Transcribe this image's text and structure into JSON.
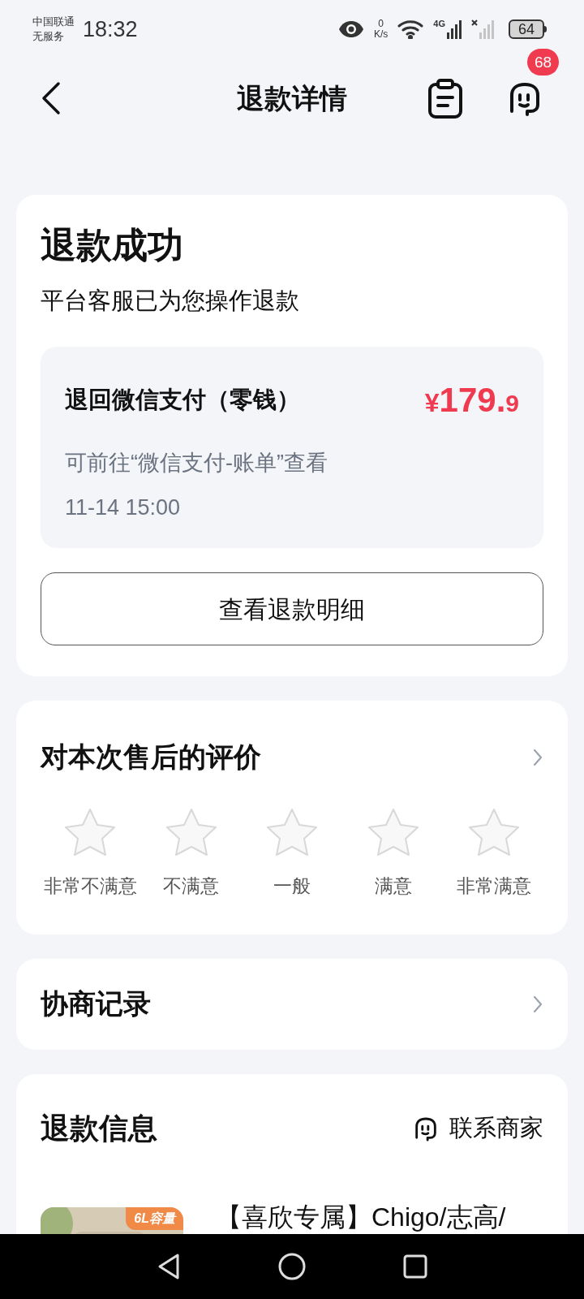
{
  "status_bar": {
    "carrier": "中国联通",
    "service": "无服务",
    "time": "18:32",
    "speed_value": "0",
    "speed_unit": "K/s",
    "network": "4G",
    "battery": "64"
  },
  "header": {
    "title": "退款详情",
    "message_badge": "68"
  },
  "refund_status": {
    "title": "退款成功",
    "subtitle": "平台客服已为您操作退款",
    "destination": "退回微信支付（零钱）",
    "amount_symbol": "¥",
    "amount_integer": "179.",
    "amount_decimal": "9",
    "hint": "可前往“微信支付-账单”查看",
    "time": "11-14 15:00",
    "button": "查看退款明细"
  },
  "rating": {
    "title": "对本次售后的评价",
    "stars": 0,
    "options": [
      "非常不满意",
      "不满意",
      "一般",
      "满意",
      "非常满意"
    ]
  },
  "negotiation": {
    "title": "协商记录"
  },
  "refund_info": {
    "title": "退款信息",
    "contact": "联系商家",
    "product": {
      "tag": "6L容量",
      "title": "【喜欣专属】Chigo/志高/"
    }
  }
}
